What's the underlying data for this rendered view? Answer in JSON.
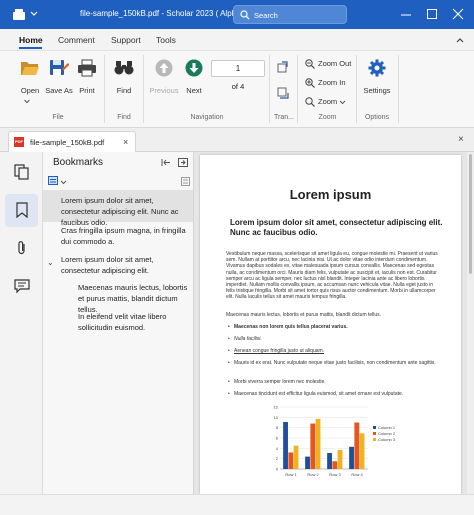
{
  "window": {
    "title": "file-sample_150kB.pdf - Scholar 2023 ( Alpha 3 )",
    "search_placeholder": "Search"
  },
  "ribbon_tabs": [
    "Home",
    "Comment",
    "Support",
    "Tools"
  ],
  "ribbon": {
    "file": {
      "open": "Open",
      "save_as": "Save As",
      "print": "Print",
      "group": "File"
    },
    "find": {
      "find": "Find",
      "group": "Find"
    },
    "navigation": {
      "previous": "Previous",
      "next": "Next",
      "page_value": "1",
      "of_pages": "of 4",
      "group": "Navigation"
    },
    "transform": {
      "group": "Tran..."
    },
    "zoom": {
      "zoom_out": "Zoom Out",
      "zoom_in": "Zoom In",
      "zoom": "Zoom",
      "group": "Zoom"
    },
    "options": {
      "settings": "Settings",
      "group": "Options"
    }
  },
  "document_tab": {
    "name": "file-sample_150kB.pdf"
  },
  "bookmarks": {
    "title": "Bookmarks",
    "items": [
      {
        "text": "Lorem ipsum dolor sit amet, consectetur adipiscing elit. Nunc ac faucibus odio.",
        "selected": true
      },
      {
        "text": "Cras fringilla ipsum magna, in fringilla dui commodo a."
      },
      {
        "text": "Lorem ipsum dolor sit amet, consectetur adipiscing elit.",
        "expanded": true
      },
      {
        "text": "Maecenas mauris lectus, lobortis et purus mattis, blandit dictum tellus.",
        "child": true
      },
      {
        "text": "In eleifend velit vitae libero sollicitudin euismod.",
        "child": true
      }
    ]
  },
  "page": {
    "title": "Lorem ipsum",
    "subtitle": "Lorem ipsum dolor sit amet, consectetur adipiscing elit. Nunc ac faucibus odio.",
    "paragraph1": "Vestibulum neque massa, scelerisque sit amet ligula eu, congue molestie mi. Praesent ut varius sem. Nullam at porttitor arcu, nec lacinia nisi. Ut ac dolor vitae odio interdum condimentum. Vivamus dapibus sodales ex, vitae malesuada ipsum cursus convallis. Maecenas sed egestas nulla, ac condimentum orci. Mauris diam felis, vulputate ac suscipit et, iaculis non est. Curabitur semper arcu ac ligula semper, nec luctus nisl blandit. Integer lacinia ante ac libero lobortis imperdiet. Nullam mollis convallis ipsum, ac accumsan nunc vehicula vitae. Nulla eget justo in felis tristique fringilla. Morbi sit amet tortor quis risus auctor condimentum. Morbi in ullamcorper elit. Nulla iaculis tellus sit amet mauris tempus fringilla.",
    "paragraph2": "Maecenas mauris lectus, lobortis et purus mattis, blandit dictum tellus.",
    "list": [
      {
        "text": "Maecenas non lorem quis tellus placerat varius.",
        "style": "b"
      },
      {
        "text": "Nulla facilisi.",
        "style": "i"
      },
      {
        "text": "Aenean congue fringilla justo ut aliquam.",
        "style": "u"
      },
      {
        "text": "Mauris id ex erat. Nunc vulputate neque vitae justo facilisis, non condimentum ante sagittis.",
        "style": ""
      },
      {
        "text": "Morbi viverra semper lorem nec molestie.",
        "style": ""
      },
      {
        "text": "Maecenas tincidunt est efficitur ligula euismod, sit amet ornare est vulputate.",
        "style": ""
      }
    ]
  },
  "chart_data": {
    "type": "bar",
    "categories": [
      "Row 1",
      "Row 2",
      "Row 3",
      "Row 4"
    ],
    "series": [
      {
        "name": "Column 1",
        "values": [
          9.1,
          2.4,
          3.1,
          4.3
        ],
        "color": "#1f4e9c"
      },
      {
        "name": "Column 2",
        "values": [
          3.2,
          8.8,
          1.5,
          9.0
        ],
        "color": "#e8541c"
      },
      {
        "name": "Column 3",
        "values": [
          4.5,
          9.7,
          3.7,
          6.9
        ],
        "color": "#f0b21e"
      }
    ],
    "yticks": [
      "0",
      "2",
      "4",
      "6",
      "8",
      "10",
      "12"
    ],
    "ylim": [
      0,
      12
    ],
    "legend": "right"
  },
  "colors": {
    "accent": "#1f5fbf",
    "ribbon_bg": "#f7f7f7",
    "selection": "#e2e2e2"
  }
}
